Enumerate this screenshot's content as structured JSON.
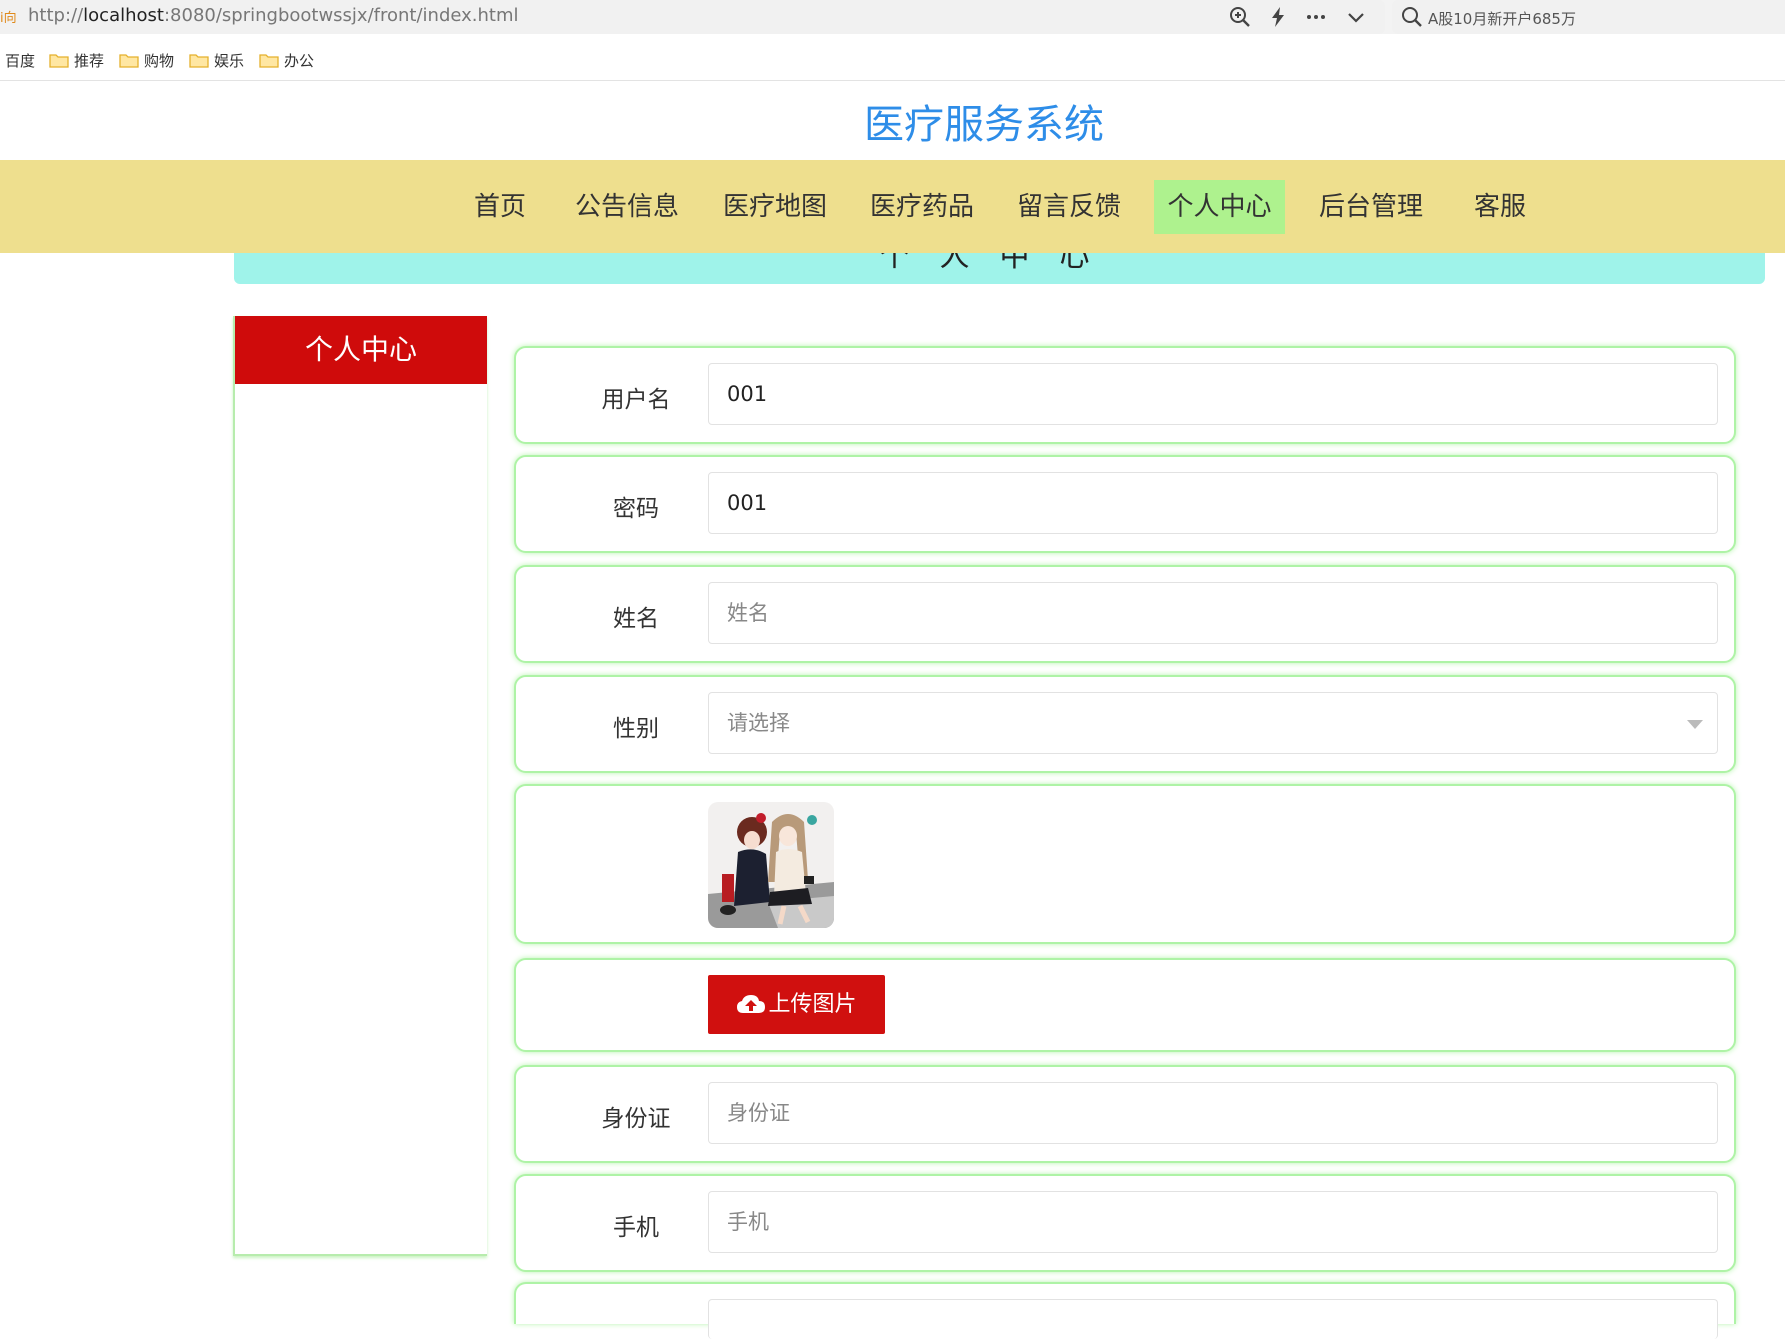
{
  "browser": {
    "url_prefix": "i向",
    "url_scheme": "http://",
    "url_host": "localhost",
    "url_path": ":8080/springbootwssjx/front/index.html",
    "search_text": "A股10月新开户685万",
    "bookmarks": [
      "百度",
      "推荐",
      "购物",
      "娱乐",
      "办公"
    ]
  },
  "site": {
    "title": "医疗服务系统",
    "nav": [
      "首页",
      "公告信息",
      "医疗地图",
      "医疗药品",
      "留言反馈",
      "个人中心",
      "后台管理",
      "客服"
    ],
    "active_nav": "个人中心",
    "banner": "个人中心"
  },
  "sidebar": {
    "header": "个人中心"
  },
  "form": {
    "username": {
      "label": "用户名",
      "value": "001"
    },
    "password": {
      "label": "密码",
      "value": "001"
    },
    "name": {
      "label": "姓名",
      "placeholder": "姓名"
    },
    "gender": {
      "label": "性别",
      "placeholder": "请选择"
    },
    "upload_label": "上传图片",
    "id_card": {
      "label": "身份证",
      "placeholder": "身份证"
    },
    "phone": {
      "label": "手机",
      "placeholder": "手机"
    }
  },
  "colors": {
    "title": "#2e8de8",
    "navbar": "#eedf8e",
    "nav_active": "#aef28e",
    "banner": "#9ff3ea",
    "sidebar_header": "#cf0b0b",
    "row_border": "#aef3a6",
    "upload_button": "#d0100f"
  },
  "icons": [
    "zoom-icon",
    "lightning-icon",
    "more-icon",
    "chevron-down-icon",
    "search-icon",
    "folder-icon",
    "cloud-upload-icon",
    "avatar-image"
  ]
}
